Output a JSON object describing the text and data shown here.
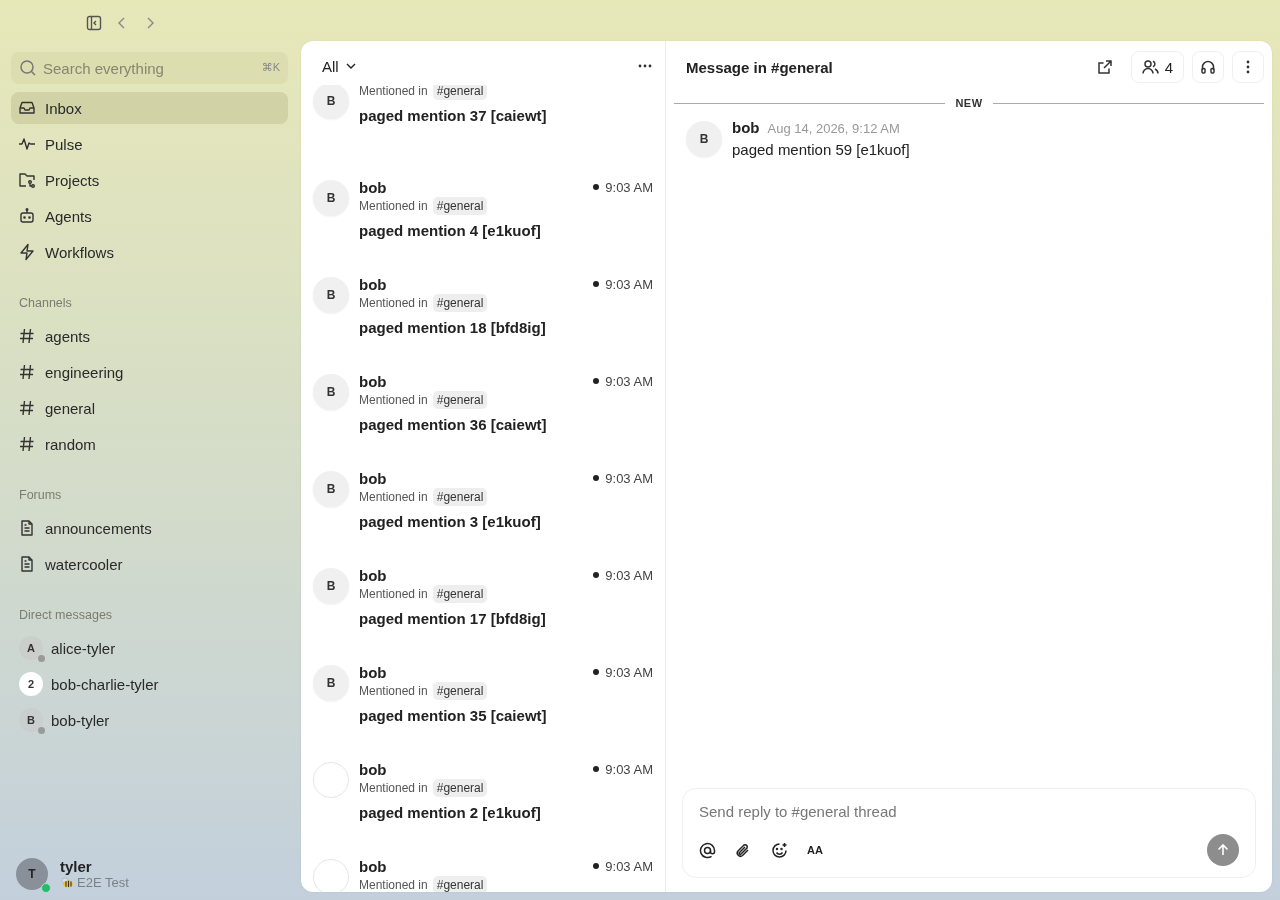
{
  "search": {
    "placeholder": "Search everything",
    "shortcut": "⌘K"
  },
  "nav_items": [
    {
      "label": "Inbox",
      "selected": true
    },
    {
      "label": "Pulse",
      "selected": false
    },
    {
      "label": "Projects",
      "selected": false
    },
    {
      "label": "Agents",
      "selected": false
    },
    {
      "label": "Workflows",
      "selected": false
    }
  ],
  "sections": [
    {
      "title": "Channels",
      "items": [
        {
          "label": "agents",
          "kind": "channel"
        },
        {
          "label": "engineering",
          "kind": "channel"
        },
        {
          "label": "general",
          "kind": "channel"
        },
        {
          "label": "random",
          "kind": "channel"
        }
      ]
    },
    {
      "title": "Forums",
      "items": [
        {
          "label": "announcements",
          "kind": "forum"
        },
        {
          "label": "watercooler",
          "kind": "forum"
        }
      ]
    },
    {
      "title": "Direct messages",
      "items": [
        {
          "label": "alice-tyler",
          "kind": "dm",
          "initial": "A",
          "online": false
        },
        {
          "label": "bob-charlie-tyler",
          "kind": "group",
          "count": "2"
        },
        {
          "label": "bob-tyler",
          "kind": "dm",
          "initial": "B",
          "online": false
        }
      ]
    }
  ],
  "user": {
    "name": "tyler",
    "initial": "T",
    "online": true,
    "status": "E2E Test"
  },
  "inbox": {
    "filter": "All",
    "items": [
      {
        "initial": "B",
        "mention_label": "Mentioned in",
        "channel": "#general",
        "message": "paged mention 37 [caiewt]"
      },
      {
        "initial": "B",
        "author": "bob",
        "time": "9:03 AM",
        "unread": true,
        "mention_label": "Mentioned in",
        "channel": "#general",
        "message": "paged mention 4 [e1kuof]"
      },
      {
        "initial": "B",
        "author": "bob",
        "time": "9:03 AM",
        "unread": true,
        "mention_label": "Mentioned in",
        "channel": "#general",
        "message": "paged mention 18 [bfd8ig]"
      },
      {
        "initial": "B",
        "author": "bob",
        "time": "9:03 AM",
        "unread": true,
        "mention_label": "Mentioned in",
        "channel": "#general",
        "message": "paged mention 36 [caiewt]"
      },
      {
        "initial": "B",
        "author": "bob",
        "time": "9:03 AM",
        "unread": true,
        "mention_label": "Mentioned in",
        "channel": "#general",
        "message": "paged mention 3 [e1kuof]"
      },
      {
        "initial": "B",
        "author": "bob",
        "time": "9:03 AM",
        "unread": true,
        "mention_label": "Mentioned in",
        "channel": "#general",
        "message": "paged mention 17 [bfd8ig]"
      },
      {
        "initial": "B",
        "author": "bob",
        "time": "9:03 AM",
        "unread": true,
        "mention_label": "Mentioned in",
        "channel": "#general",
        "message": "paged mention 35 [caiewt]"
      },
      {
        "author": "bob",
        "time": "9:03 AM",
        "unread": true,
        "mention_label": "Mentioned in",
        "channel": "#general",
        "message": "paged mention 2 [e1kuof]"
      },
      {
        "author": "bob",
        "time": "9:03 AM",
        "unread": true,
        "mention_label": "Mentioned in",
        "channel": "#general"
      }
    ]
  },
  "thread": {
    "title": "Message in #general",
    "member_count": "4",
    "divider": "NEW",
    "messages": [
      {
        "author": "bob",
        "initial": "B",
        "time": "Aug 14, 2026, 9:12 AM",
        "text": "paged mention 59 [e1kuof]"
      }
    ],
    "composer": {
      "placeholder": "Send reply to #general thread",
      "format_label": "AA"
    }
  }
}
